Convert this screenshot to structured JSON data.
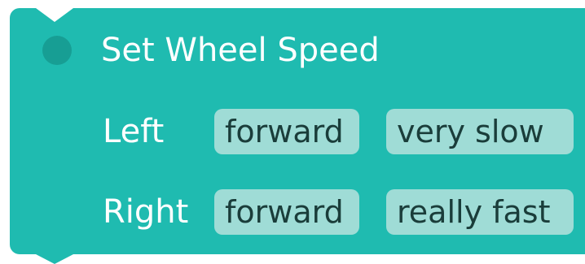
{
  "block": {
    "title": "Set Wheel Speed",
    "colors": {
      "background": "#1fbbb0",
      "dot": "#179e94",
      "pill": "#9fdcd6"
    },
    "rows": [
      {
        "label": "Left",
        "direction": "forward",
        "speed": "very slow"
      },
      {
        "label": "Right",
        "direction": "forward",
        "speed": "really fast"
      }
    ]
  }
}
